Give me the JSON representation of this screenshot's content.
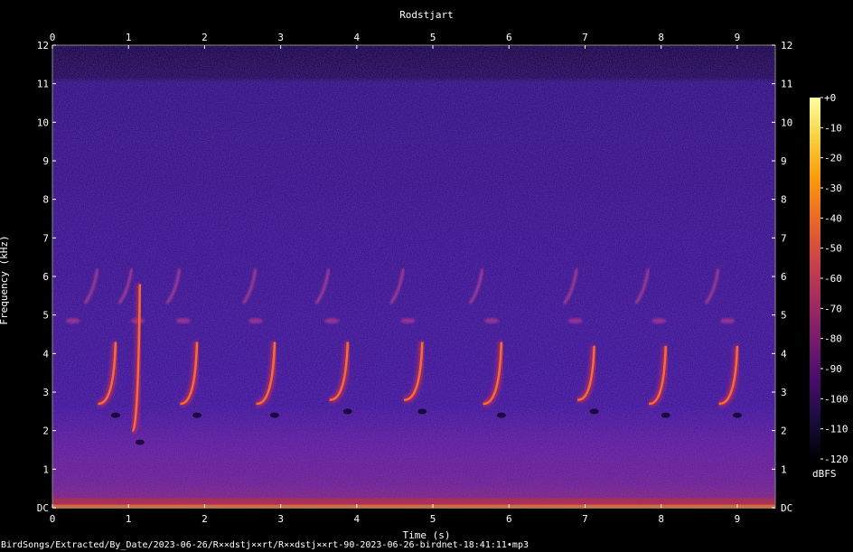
{
  "title": "Rodstjart",
  "filepath": "BirdSongs/Extracted/By_Date/2023-06-26/R××dstj××rt/R××dstj××rt-90-2023-06-26-birdnet-18:41:11•mp3",
  "colorbar_unit": "dBFS",
  "colors": {
    "background": "#000000",
    "spectrogram_base": "#2a1170",
    "call": "#ff5a1a"
  },
  "chart_data": {
    "type": "heatmap",
    "title": "Rodstjart",
    "xlabel": "Time (s)",
    "ylabel": "Frequency (kHz)",
    "xlim": [
      0,
      9.5
    ],
    "ylim": [
      0,
      12
    ],
    "x_ticks": [
      "0",
      "1",
      "2",
      "3",
      "4",
      "5",
      "6",
      "7",
      "8",
      "9"
    ],
    "y_ticks": [
      "DC",
      "1",
      "2",
      "3",
      "4",
      "5",
      "6",
      "7",
      "8",
      "9",
      "10",
      "11",
      "12"
    ],
    "colorbar": {
      "unit": "dBFS",
      "range": [
        -120,
        0
      ],
      "ticks": [
        "+0",
        "-10",
        "-20",
        "-30",
        "-40",
        "-50",
        "-60",
        "-70",
        "-80",
        "-90",
        "-100",
        "-110",
        "-120"
      ],
      "colormap": [
        "#000004",
        "#1b0c41",
        "#4a0c6b",
        "#781c6d",
        "#a52c60",
        "#cf4446",
        "#ed6925",
        "#fb9b06",
        "#f7d13d",
        "#fcffa4"
      ]
    },
    "calls": [
      {
        "t": 0.2,
        "chirp_start_khz": 2.7,
        "chirp_end_khz": 4.3,
        "start_t": 0.6,
        "end_t": 0.83
      },
      {
        "t": 1.05,
        "chirp_start_khz": 2.0,
        "chirp_end_khz": 5.8,
        "start_t": 1.05,
        "end_t": 1.15
      },
      {
        "t": 1.65,
        "chirp_start_khz": 2.7,
        "chirp_end_khz": 4.3,
        "start_t": 1.68,
        "end_t": 1.9
      },
      {
        "t": 2.6,
        "chirp_start_khz": 2.7,
        "chirp_end_khz": 4.3,
        "start_t": 2.68,
        "end_t": 2.92
      },
      {
        "t": 3.6,
        "chirp_start_khz": 2.8,
        "chirp_end_khz": 4.3,
        "start_t": 3.64,
        "end_t": 3.88
      },
      {
        "t": 4.6,
        "chirp_start_khz": 2.8,
        "chirp_end_khz": 4.3,
        "start_t": 4.62,
        "end_t": 4.86
      },
      {
        "t": 5.7,
        "chirp_start_khz": 2.7,
        "chirp_end_khz": 4.3,
        "start_t": 5.66,
        "end_t": 5.9
      },
      {
        "t": 6.8,
        "chirp_start_khz": 2.8,
        "chirp_end_khz": 4.2,
        "start_t": 6.9,
        "end_t": 7.12
      },
      {
        "t": 7.9,
        "chirp_start_khz": 2.7,
        "chirp_end_khz": 4.2,
        "start_t": 7.84,
        "end_t": 8.06
      },
      {
        "t": 8.8,
        "chirp_start_khz": 2.7,
        "chirp_end_khz": 4.2,
        "start_t": 8.76,
        "end_t": 9.0
      }
    ]
  }
}
